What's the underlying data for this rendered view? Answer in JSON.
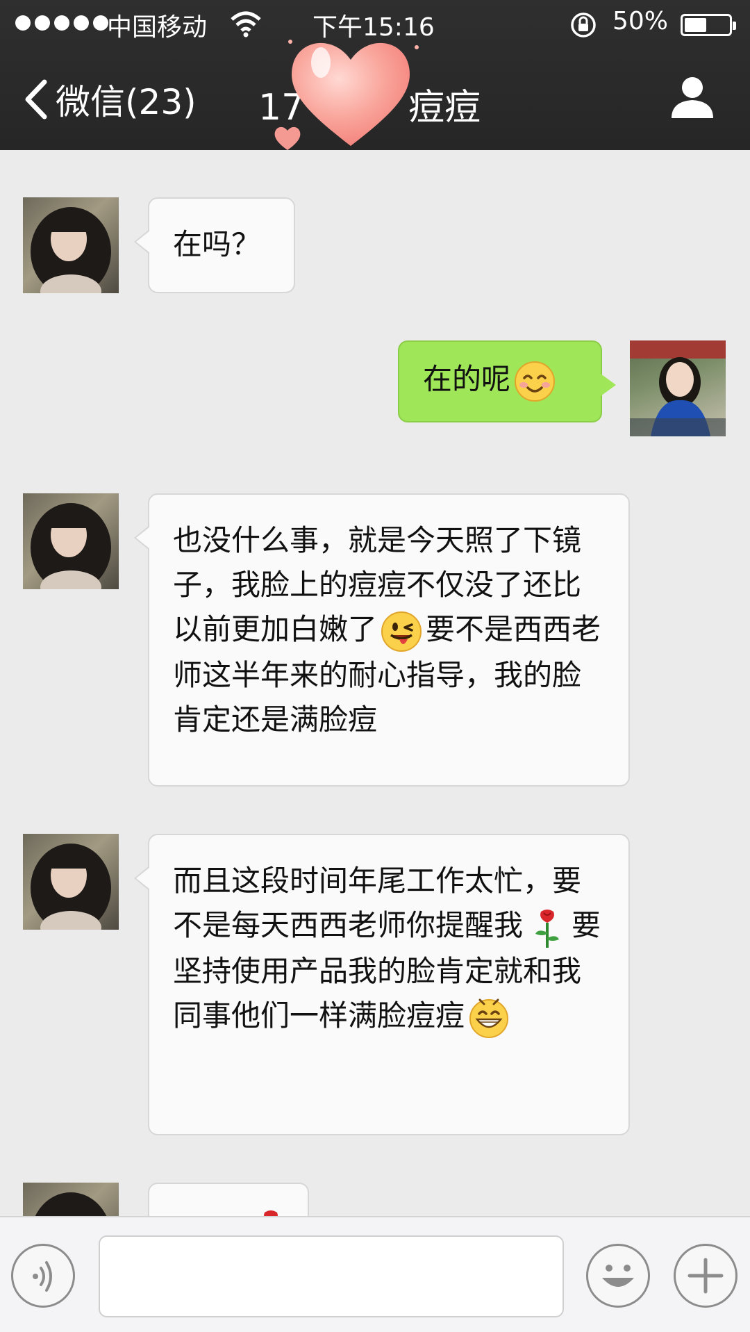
{
  "status_bar": {
    "carrier": "中国移动",
    "time": "下午15:16",
    "battery": "50%",
    "battery_level": 0.5,
    "icons": [
      "signal-dots-icon",
      "wifi-icon",
      "rotation-lock-icon",
      "battery-icon"
    ]
  },
  "nav": {
    "back_label": "微信(23)",
    "title_prefix": "17",
    "title_suffix": "痘痘",
    "icons": [
      "chevron-left-icon",
      "heart-sticker-icon",
      "profile-icon"
    ]
  },
  "messages": [
    {
      "side": "left",
      "text": "在吗？"
    },
    {
      "side": "right",
      "text": "在的呢",
      "emoji": "smile-emoji-icon"
    },
    {
      "side": "left",
      "text_a": "也没什么事，就是今天照了下镜子，我脸上的痘痘不仅没了还比以前更加白嫩了",
      "emoji": "wink-tongue-emoji-icon",
      "text_b": "要不是西西老师这半年来的耐心指导，我的脸肯定还是满脸痘"
    },
    {
      "side": "left",
      "text_a": "而且这段时间年尾工作太忙，要不是每天西西老师你提醒我",
      "emoji_a": "rose-emoji-icon",
      "text_b": "要坚持使用产品我的脸肯定就和我同事他们一样满脸痘痘",
      "emoji_b": "grin-emoji-icon"
    },
    {
      "side": "left",
      "text": "",
      "emoji": "rose-emoji-icon"
    }
  ],
  "input_bar": {
    "placeholder": "",
    "icons": [
      "voice-icon",
      "emoji-face-icon",
      "plus-icon"
    ]
  },
  "colors": {
    "nav_bg": "#262626",
    "chat_bg": "#ebebeb",
    "sent_bubble": "#9fe658",
    "received_bubble": "#fafafa"
  }
}
